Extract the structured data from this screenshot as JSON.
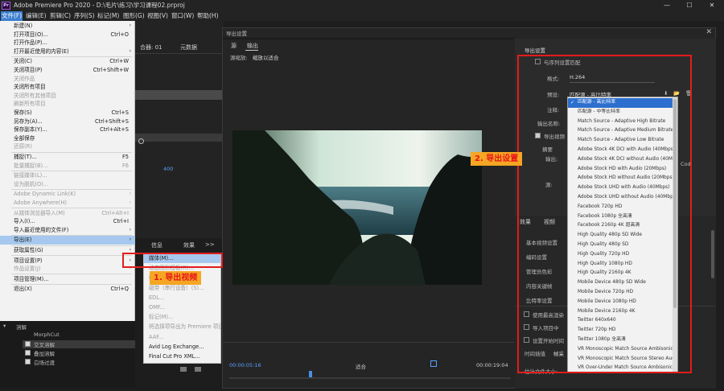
{
  "app": {
    "logo_text": "Pr",
    "title": "Adobe Premiere Pro 2020 - D:\\毛片\\练习\\学习课程02.prproj",
    "window_controls": [
      "—",
      "☐",
      "✕"
    ]
  },
  "menubar": [
    "文件(F)",
    "编辑(E)",
    "剪辑(C)",
    "序列(S)",
    "标记(M)",
    "图形(G)",
    "视图(V)",
    "窗口(W)",
    "帮助(H)"
  ],
  "background": {
    "panel_tabs": [
      "合器: 01",
      "元数据"
    ],
    "lower_tabs": [
      "信息",
      "效果",
      ">>"
    ],
    "timecode": "400"
  },
  "file_menu": {
    "items": [
      {
        "label": "新建(N)",
        "shortcut": "",
        "arrow": true,
        "disabled": false
      },
      {
        "label": "打开项目(O)...",
        "shortcut": "Ctrl+O",
        "arrow": false,
        "disabled": false
      },
      {
        "label": "打开作品(P)...",
        "shortcut": "",
        "arrow": false,
        "disabled": false
      },
      {
        "label": "打开最近使用的内容(E)",
        "shortcut": "",
        "arrow": true,
        "disabled": false
      },
      {
        "sep": true
      },
      {
        "label": "关闭(C)",
        "shortcut": "Ctrl+W",
        "arrow": false,
        "disabled": false
      },
      {
        "label": "关闭项目(P)",
        "shortcut": "Ctrl+Shift+W",
        "arrow": false,
        "disabled": false
      },
      {
        "label": "关闭作品",
        "shortcut": "",
        "arrow": false,
        "disabled": true
      },
      {
        "label": "关闭所有项目",
        "shortcut": "",
        "arrow": false,
        "disabled": false
      },
      {
        "label": "关闭所有其他项目",
        "shortcut": "",
        "arrow": false,
        "disabled": true
      },
      {
        "label": "刷新所有项目",
        "shortcut": "",
        "arrow": false,
        "disabled": true
      },
      {
        "label": "保存(S)",
        "shortcut": "Ctrl+S",
        "arrow": false,
        "disabled": false
      },
      {
        "label": "另存为(A)...",
        "shortcut": "Ctrl+Shift+S",
        "arrow": false,
        "disabled": false
      },
      {
        "label": "保存副本(Y)...",
        "shortcut": "Ctrl+Alt+S",
        "arrow": false,
        "disabled": false
      },
      {
        "label": "全部保存",
        "shortcut": "",
        "arrow": false,
        "disabled": false
      },
      {
        "label": "还原(R)",
        "shortcut": "",
        "arrow": false,
        "disabled": true
      },
      {
        "sep": true
      },
      {
        "label": "捕捉(T)...",
        "shortcut": "F5",
        "arrow": false,
        "disabled": false
      },
      {
        "label": "批量捕捉(B)...",
        "shortcut": "F6",
        "arrow": false,
        "disabled": true
      },
      {
        "sep": true
      },
      {
        "label": "链接媒体(L)...",
        "shortcut": "",
        "arrow": false,
        "disabled": true
      },
      {
        "label": "设为脱机(O)...",
        "shortcut": "",
        "arrow": false,
        "disabled": true
      },
      {
        "sep": true
      },
      {
        "label": "Adobe Dynamic Link(K)",
        "shortcut": "",
        "arrow": true,
        "disabled": true
      },
      {
        "label": "Adobe Anywhere(H)",
        "shortcut": "",
        "arrow": true,
        "disabled": true
      },
      {
        "sep": true
      },
      {
        "label": "从媒体浏览器导入(M)",
        "shortcut": "Ctrl+Alt+I",
        "arrow": false,
        "disabled": true
      },
      {
        "label": "导入(I)...",
        "shortcut": "Ctrl+I",
        "arrow": false,
        "disabled": false
      },
      {
        "label": "导入最近使用的文件(F)",
        "shortcut": "",
        "arrow": true,
        "disabled": false
      },
      {
        "sep": true
      },
      {
        "label": "导出(E)",
        "shortcut": "",
        "arrow": true,
        "disabled": false,
        "highlight": true
      },
      {
        "sep": true
      },
      {
        "label": "获取属性(G)",
        "shortcut": "",
        "arrow": true,
        "disabled": false
      },
      {
        "sep": true
      },
      {
        "label": "项目设置(P)",
        "shortcut": "",
        "arrow": true,
        "disabled": false
      },
      {
        "label": "作品设置(J)",
        "shortcut": "",
        "arrow": true,
        "disabled": true
      },
      {
        "sep": true
      },
      {
        "label": "项目管理(M)...",
        "shortcut": "",
        "arrow": false,
        "disabled": false
      },
      {
        "sep": true
      },
      {
        "label": "退出(X)",
        "shortcut": "Ctrl+Q",
        "arrow": false,
        "disabled": false
      }
    ]
  },
  "export_submenu": {
    "items": [
      {
        "label": "媒体(M)...",
        "disabled": false,
        "highlight": true
      },
      {
        "label": "动态图形模板(R)...",
        "disabled": true
      },
      {
        "label": "磁带 (DV/HDV)(T)...",
        "disabled": true
      },
      {
        "label": "磁带（串行设备）(S)...",
        "disabled": true
      },
      {
        "label": "EDL...",
        "disabled": true
      },
      {
        "label": "OMF...",
        "disabled": true
      },
      {
        "label": "标记(M)...",
        "disabled": true
      },
      {
        "label": "将选择项导出为 Premiere 项目...",
        "disabled": true
      },
      {
        "label": "AAF...",
        "disabled": true
      },
      {
        "label": "Avid Log Exchange...",
        "disabled": false
      },
      {
        "label": "Final Cut Pro XML...",
        "disabled": false
      }
    ]
  },
  "annotations": {
    "step1": "1. 导出视频",
    "step2": "2. 导出设置"
  },
  "dialog": {
    "title": "导出设置",
    "close": "✕",
    "tabs": [
      "源",
      "输出"
    ],
    "source_scaling_label": "源缩放:",
    "source_scaling_value": "缩放以适合",
    "timecode_start": "00:00:05:16",
    "timecode_end": "00:00:19:04",
    "fit_label": "适合"
  },
  "export_settings": {
    "header": "导出设置",
    "match_sequence": "与序列设置匹配",
    "format_label": "格式:",
    "format_value": "H.264",
    "preset_label": "预设:",
    "preset_value": "匹配源 - 高比特率",
    "comment_label": "注释:",
    "output_name_label": "输出名称:",
    "export_video_label": "导出视频",
    "summary_label": "摘要",
    "output_label": "输出:",
    "source_label": "源:",
    "tabs": [
      "效果",
      "视频"
    ],
    "sections": [
      "基本视频设置",
      "编码设置",
      "管理员色彩",
      "内容关键帧",
      "比特率设置"
    ],
    "checkboxes": [
      "使用最高渲染",
      "导入项目中",
      "设置开始时间",
      "时间插值"
    ],
    "time_interp_value": "帧采",
    "estimated_size_label": "估计文件大小:",
    "cod_fragment": "Cod"
  },
  "presets": {
    "items": [
      {
        "label": "匹配源 - 高比特率",
        "selected": true
      },
      {
        "label": "匹配源 - 中等比特率",
        "selected": false
      },
      {
        "label": "Match Source - Adaptive High Bitrate",
        "selected": false
      },
      {
        "label": "Match Source - Adaptive Medium Bitrate",
        "selected": false
      },
      {
        "label": "Match Source - Adaptive Low Bitrate",
        "selected": false
      },
      {
        "label": "Adobe Stock 4K DCI with Audio (40Mbps)",
        "selected": false
      },
      {
        "label": "Adobe Stock 4K DCI without Audio (40Mbps)",
        "selected": false
      },
      {
        "label": "Adobe Stock HD with Audio (20Mbps)",
        "selected": false
      },
      {
        "label": "Adobe Stock HD without Audio (20Mbps)",
        "selected": false
      },
      {
        "label": "Adobe Stock UHD with Audio (40Mbps)",
        "selected": false
      },
      {
        "label": "Adobe Stock UHD without Audio (40Mbps)",
        "selected": false
      },
      {
        "label": "Facebook 720p HD",
        "selected": false
      },
      {
        "label": "Facebook 1080p 全高清",
        "selected": false
      },
      {
        "label": "Facebook 2160p 4K 超高清",
        "selected": false
      },
      {
        "label": "High Quality 480p SD Wide",
        "selected": false
      },
      {
        "label": "High Quality 480p SD",
        "selected": false
      },
      {
        "label": "High Quality 720p HD",
        "selected": false
      },
      {
        "label": "High Quality 1080p HD",
        "selected": false
      },
      {
        "label": "High Quality 2160p 4K",
        "selected": false
      },
      {
        "label": "Mobile Device 480p SD Wide",
        "selected": false
      },
      {
        "label": "Mobile Device 720p HD",
        "selected": false
      },
      {
        "label": "Mobile Device 1080p HD",
        "selected": false
      },
      {
        "label": "Mobile Device 2160p 4K",
        "selected": false
      },
      {
        "label": "Twitter 640x640",
        "selected": false
      },
      {
        "label": "Twitter 720p HD",
        "selected": false
      },
      {
        "label": "Twitter 1080p 全高清",
        "selected": false
      },
      {
        "label": "VR Monoscopic Match Source Ambisonics",
        "selected": false
      },
      {
        "label": "VR Monoscopic Match Source Stereo Audio",
        "selected": false
      },
      {
        "label": "VR Over-Under Match Source Ambisonics",
        "selected": false
      }
    ]
  },
  "effects_panel": {
    "items": [
      "溶解",
      "MorphCut",
      "交叉溶解",
      "叠加溶解",
      "白场过渡"
    ]
  }
}
